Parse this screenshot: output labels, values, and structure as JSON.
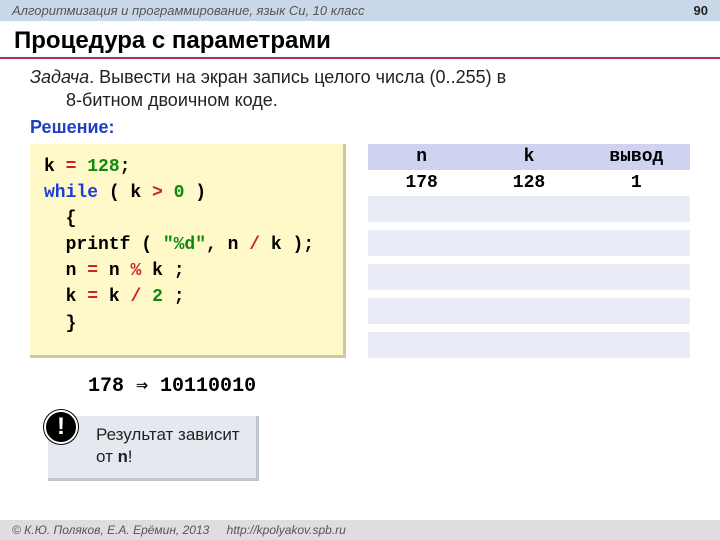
{
  "header": {
    "course": "Алгоритмизация и программирование, язык Си, 10 класс",
    "page": "90"
  },
  "title": "Процедура с параметрами",
  "task": {
    "label": "Задача",
    "text1": ". Вывести на экран запись целого числа (0..255) в",
    "text2": "8-битном двоичном коде."
  },
  "solution_label": "Решение:",
  "code": {
    "l1a": "k",
    "l1b": "=",
    "l1c": "128",
    "l1d": ";",
    "l2a": "while",
    "l2b": " ( k ",
    "l2c": ">",
    "l2d": " ",
    "l2e": "0",
    "l2f": " )",
    "l3": "  {",
    "l4a": "  printf ( ",
    "l4b": "\"%d\"",
    "l4c": ", n",
    "l4d": "/",
    "l4e": "k );",
    "l5a": "  n",
    "l5b": "=",
    "l5c": "n",
    "l5d": "%",
    "l5e": "k ;",
    "l6a": "  k",
    "l6b": "=",
    "l6c": "k",
    "l6d": "/",
    "l6e": "2",
    "l6f": ";",
    "l7": "  }"
  },
  "trace": {
    "headers": [
      "n",
      "k",
      "вывод"
    ],
    "rows": [
      {
        "n": "178",
        "k": "128",
        "out": "1"
      },
      {
        "n": "",
        "k": "",
        "out": ""
      },
      {
        "n": "",
        "k": "",
        "out": ""
      },
      {
        "n": "",
        "k": "",
        "out": ""
      },
      {
        "n": "",
        "k": "",
        "out": ""
      },
      {
        "n": "",
        "k": "",
        "out": ""
      }
    ]
  },
  "result": "178 ⇒ 10110010",
  "note": {
    "bang": "!",
    "line1": " Результат зависит",
    "line2_a": "от ",
    "line2_b": "n",
    "line2_c": "!"
  },
  "footer": {
    "copyright": "© К.Ю. Поляков, Е.А. Ерёмин, 2013",
    "url": "http://kpolyakov.spb.ru"
  }
}
